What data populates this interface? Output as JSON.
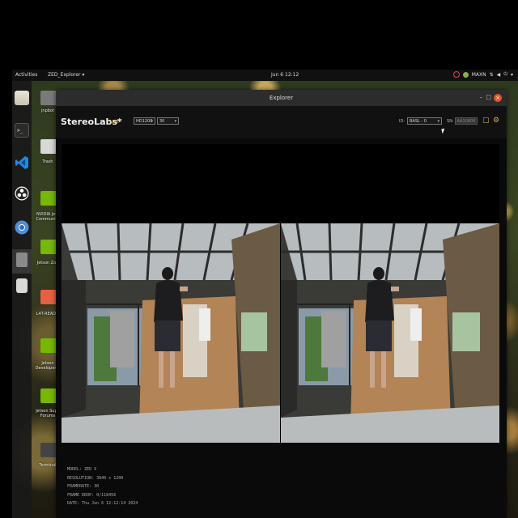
{
  "topbar": {
    "activities": "Activities",
    "app_menu": "ZED_Explorer ▾",
    "clock": "Jun 6  12:12",
    "power_mode": "MAXN"
  },
  "dock": {
    "items": [
      {
        "name": "files",
        "icon": "folder-icon"
      },
      {
        "name": "terminal",
        "icon": "terminal-icon"
      },
      {
        "name": "vscode",
        "icon": "vscode-icon"
      },
      {
        "name": "obs",
        "icon": "obs-icon"
      },
      {
        "name": "chromium",
        "icon": "chromium-icon"
      },
      {
        "name": "zed-explorer",
        "icon": "zed-explorer-icon"
      },
      {
        "name": "storage",
        "icon": "drive-icon"
      }
    ]
  },
  "desktop": {
    "icons": [
      {
        "label": "jnpbot"
      },
      {
        "label": "Trash"
      },
      {
        "label": "NVIDIA Jets Community"
      },
      {
        "label": "Jetson Zoo"
      },
      {
        "label": "L4T-READM"
      },
      {
        "label": "Jetson Developer Z"
      },
      {
        "label": "Jetson Supp Forums"
      },
      {
        "label": "Terminal"
      }
    ]
  },
  "window": {
    "title": "Explorer",
    "minimize": "–",
    "maximize": "□",
    "close": "×",
    "brand": "StereoLabs*",
    "live_label": "LIVE",
    "resolution_select": "HD1200",
    "fps_select": "30",
    "id_label": "ID:",
    "camera_select": "BASL - 0",
    "sn_label": "SN:",
    "sn_value": "AA10806"
  },
  "info": {
    "model": "MODEL: ZED X",
    "resolution": "RESOLUTION: 3840 x 1200",
    "framerate": "FRAMERATE: 30",
    "frame_drop": "FRAME DROP: 0/118456",
    "date": "DATE: Thu Jun 6 12:12:14 2024"
  },
  "colors": {
    "accent": "#e0b84a",
    "close_button": "#e95420",
    "nvidia_green": "#76b900"
  }
}
